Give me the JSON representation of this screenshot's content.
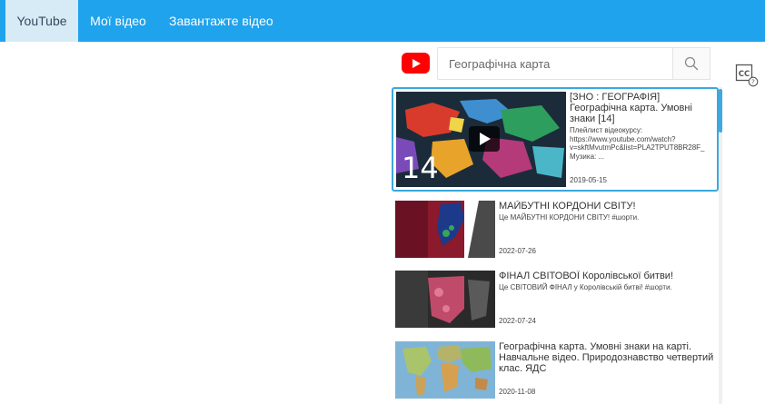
{
  "tabs": [
    {
      "label": "YouTube",
      "active": true
    },
    {
      "label": "Мої відео",
      "active": false
    },
    {
      "label": "Завантажте відео",
      "active": false
    }
  ],
  "search": {
    "value": "Географічна карта",
    "placeholder": ""
  },
  "icons": {
    "youtube_logo": "youtube-logo-icon",
    "search": "search-icon",
    "captions": "closed-captions-help-icon",
    "play": "play-icon"
  },
  "colors": {
    "tabbar": "#1fa3ec",
    "active_tab": "#d6ebf6",
    "highlight_border": "#3aa8df",
    "youtube_red": "#ff0000"
  },
  "results": [
    {
      "title": "[ЗНО : ГЕОГРАФІЯ] Географічна карта. Умовні знаки [14]",
      "description": "Плейлист відеокурсу: https://www.youtube.com/watch?v=skftMvutmPc&list=PLA2TPUT8BR28F_\nМузика: ...",
      "date": "2019-05-15",
      "thumb_label": "14"
    },
    {
      "title": "МАЙБУТНІ КОРДОНИ СВІТУ!",
      "description": "Це МАЙБУТНІ КОРДОНИ СВІТУ! #шорти.",
      "date": "2022-07-26"
    },
    {
      "title": "ФІНАЛ СВІТОВОЇ Королівської битви!",
      "description": "Це СВІТОВИЙ ФІНАЛ у Королівській битві! #шорти.",
      "date": "2022-07-24"
    },
    {
      "title": "Географічна карта. Умовні знаки на карті. Навчальне відео. Природознавство четвертий клас. ЯДС",
      "description": "",
      "date": "2020-11-08"
    }
  ]
}
